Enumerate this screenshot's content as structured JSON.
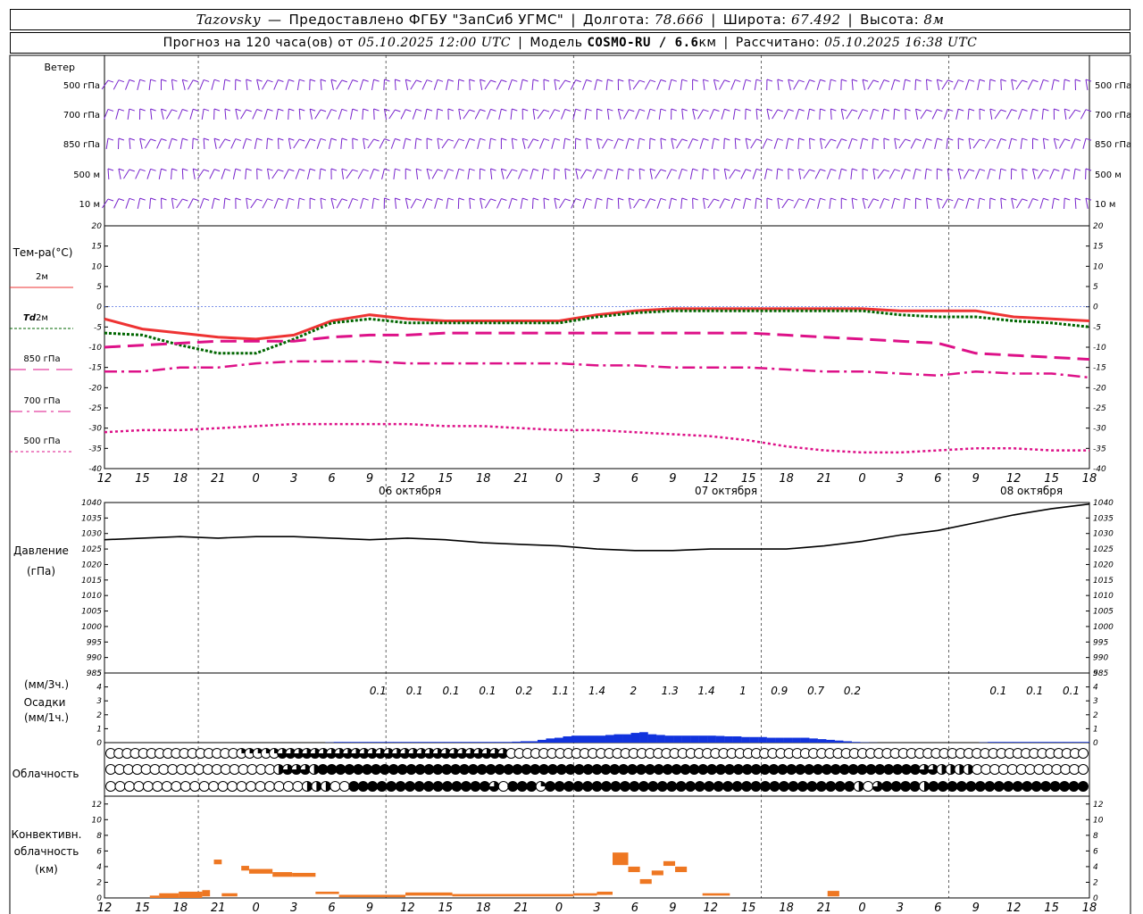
{
  "header": {
    "station": "Tazovsky",
    "dash": "—",
    "provider": "Предоставлено ФГБУ \"ЗапСиб УГМС\"",
    "lon_label": "Долгота:",
    "lon_value": "78.666",
    "lat_label": "Широта:",
    "lat_value": "67.492",
    "alt_label": "Высота:",
    "alt_value": "8м",
    "forecast_label": "Прогноз на 120 часа(ов) от",
    "forecast_time": "05.10.2025 12:00 UTC",
    "model_label": "Модель",
    "model_name": "COSMO-RU / 6.6",
    "model_unit": "км",
    "computed_label": "Рассчитано:",
    "computed_time": "05.10.2025 16:38 UTC"
  },
  "colors": {
    "t2m": "#ee3333",
    "td2m": "#006600",
    "t850": "#dd1188",
    "t700": "#dd1188",
    "t500": "#dd1188",
    "wind": "#7722cc",
    "pressure": "#000000",
    "precip": "#1133dd",
    "convective": "#ee7722",
    "grid": "#000000"
  },
  "chart_data": [
    {
      "id": "wind",
      "type": "table",
      "title": "Ветер",
      "row_labels": [
        "500 гПа",
        "700 гПа",
        "850 гПа",
        "500 м",
        "10 м"
      ],
      "rows": [
        "FFFFFFFFFFFFFFFFFFFFFFFFFFFFFFFFFFFFFFFFFFFFFFFFFFFFFFFFFFFFFFFFFFFFFFFFFFFFFFFFFFFFFFFFFFFFF",
        "FFFFFFFFFFFFFFFFFFFFFFFFFFFFFFFFFFFFFFFFFFFFFFFFFFFFFFFFFFFFFFFFFFFFFFFFFFFFFFFFFFFFFFFFFFFFF",
        "FFFFFFFFFFFFFFFFFFFFFFFFFFFFFFFFFFFFFFFFFFFFFFFFFFFFFFFFFFFFFFFFFFFFFFFFFFFFFFFFFFFFFFFFFFFFF",
        "FFFFFFFFFFFFFFFFFFFFFFFFFFFFFFFFFFFFFFFFFFFFFFFFFFFFFFFFFFFFFFFFFFFFFFFFFFFFFFFFFFFFFFFFFFFFF",
        "FFFFFFFFFFFFFFFFFFFFFFFFFFFFFFFFFFFFFFFFFFFFFFFFFFFFFFFFFFFFFFFFFFFFFFFFFFFFFFFFFFFFFFFFFFFFF"
      ]
    },
    {
      "id": "temperature",
      "type": "line",
      "title": "Тем-ра(°С)",
      "x": [
        12,
        15,
        18,
        21,
        0,
        3,
        6,
        9,
        12,
        15,
        18,
        21,
        0,
        3,
        6,
        9,
        12,
        15,
        18,
        21,
        0,
        3,
        6,
        9,
        12,
        15,
        18
      ],
      "ylim": [
        -40,
        20
      ],
      "yticks": [
        -40,
        -35,
        -30,
        -25,
        -20,
        -15,
        -10,
        -5,
        0,
        5,
        10,
        15,
        20
      ],
      "series": [
        {
          "name": "2м",
          "values": [
            -3,
            -5.5,
            -6.5,
            -7.5,
            -8,
            -7,
            -3.5,
            -2,
            -3,
            -3.5,
            -3.5,
            -3.5,
            -3.5,
            -2,
            -1,
            -0.5,
            -0.5,
            -0.5,
            -0.5,
            -0.5,
            -0.5,
            -1,
            -1,
            -1,
            -2.5,
            -3,
            -3.5
          ]
        },
        {
          "name": "Td 2м",
          "values": [
            -6.5,
            -7,
            -9.5,
            -11.5,
            -11.5,
            -8,
            -4,
            -3,
            -4,
            -4,
            -4,
            -4,
            -4,
            -2.5,
            -1.5,
            -1,
            -1,
            -1,
            -1,
            -1,
            -1,
            -2,
            -2.5,
            -2.5,
            -3.5,
            -4,
            -5
          ]
        },
        {
          "name": "850 гПа",
          "values": [
            -10,
            -9.5,
            -9,
            -8.5,
            -8.5,
            -8.5,
            -7.5,
            -7,
            -7,
            -6.5,
            -6.5,
            -6.5,
            -6.5,
            -6.5,
            -6.5,
            -6.5,
            -6.5,
            -6.5,
            -7,
            -7.5,
            -8,
            -8.5,
            -9,
            -11.5,
            -12,
            -12.5,
            -13
          ]
        },
        {
          "name": "700 гПа",
          "values": [
            -16,
            -16,
            -15,
            -15,
            -14,
            -13.5,
            -13.5,
            -13.5,
            -14,
            -14,
            -14,
            -14,
            -14,
            -14.5,
            -14.5,
            -15,
            -15,
            -15,
            -15.5,
            -16,
            -16,
            -16.5,
            -17,
            -16,
            -16.5,
            -16.5,
            -17.5
          ]
        },
        {
          "name": "500 гПа",
          "values": [
            -31,
            -30.5,
            -30.5,
            -30,
            -29.5,
            -29,
            -29,
            -29,
            -29,
            -29.5,
            -29.5,
            -30,
            -30.5,
            -30.5,
            -31,
            -31.5,
            -32,
            -33,
            -34.5,
            -35.5,
            -36,
            -36,
            -35.5,
            -35,
            -35,
            -35.5,
            -35.5
          ]
        }
      ]
    },
    {
      "id": "pressure",
      "type": "line",
      "title": "Давление",
      "ylabel": "(гПа)",
      "x": [
        12,
        15,
        18,
        21,
        0,
        3,
        6,
        9,
        12,
        15,
        18,
        21,
        0,
        3,
        6,
        9,
        12,
        15,
        18,
        21,
        0,
        3,
        6,
        9,
        12,
        15,
        18
      ],
      "ylim": [
        985,
        1040
      ],
      "yticks": [
        985,
        990,
        995,
        1000,
        1005,
        1010,
        1015,
        1020,
        1025,
        1030,
        1035,
        1040
      ],
      "series": [
        {
          "name": "",
          "values": [
            1028,
            1028.5,
            1029,
            1028.5,
            1029,
            1029,
            1028.5,
            1028,
            1028.5,
            1028,
            1027,
            1026.5,
            1026,
            1025,
            1024.5,
            1024.5,
            1025,
            1025,
            1025,
            1026,
            1027.5,
            1029.5,
            1031,
            1033.5,
            1036,
            1038,
            1039.5
          ]
        }
      ]
    },
    {
      "id": "precipitation",
      "type": "bar",
      "title": "Осадки",
      "ylabel_top": "(мм/3ч.)",
      "ylabel_bottom": "(мм/1ч.)",
      "ylim": [
        0,
        5
      ],
      "yticks": [
        0,
        1,
        2,
        3,
        4,
        5
      ],
      "labels_3h": [
        "",
        "",
        "",
        "",
        "",
        "",
        "",
        "0.1",
        "0.1",
        "0.1",
        "0.1",
        "0.2",
        "1.1",
        "1.4",
        "2",
        "1.3",
        "1.4",
        "1",
        "0.9",
        "0.7",
        "0.2",
        "",
        "",
        "",
        "0.1",
        "0.1",
        "0.1"
      ],
      "hourly": [
        0,
        0,
        0,
        0,
        0,
        0,
        0,
        0,
        0,
        0,
        0,
        0,
        0,
        0,
        0,
        0,
        0,
        0,
        0,
        0,
        0,
        0,
        0,
        0,
        0,
        0,
        0.02,
        0.05,
        0.05,
        0.05,
        0.05,
        0.05,
        0.05,
        0.05,
        0.05,
        0.05,
        0.05,
        0.05,
        0.05,
        0.05,
        0.05,
        0.05,
        0.05,
        0.05,
        0.05,
        0.05,
        0.05,
        0.05,
        0.07,
        0.1,
        0.1,
        0.2,
        0.3,
        0.35,
        0.45,
        0.5,
        0.5,
        0.5,
        0.5,
        0.55,
        0.6,
        0.6,
        0.7,
        0.75,
        0.6,
        0.55,
        0.5,
        0.5,
        0.5,
        0.5,
        0.5,
        0.5,
        0.48,
        0.45,
        0.45,
        0.4,
        0.4,
        0.4,
        0.35,
        0.35,
        0.35,
        0.35,
        0.35,
        0.3,
        0.25,
        0.2,
        0.15,
        0.1,
        0.05,
        0.02,
        0.01,
        0,
        0,
        0,
        0,
        0,
        0,
        0,
        0,
        0,
        0,
        0,
        0,
        0.02,
        0.05,
        0.05,
        0.05,
        0.05,
        0.05,
        0.05,
        0.05,
        0.05,
        0.05,
        0.05,
        0.05,
        0.05
      ]
    },
    {
      "id": "cloudiness",
      "type": "table",
      "title": "Облачность",
      "rows": [
        "○○○○○○○○○○○○○○○○◔◔◔◔◔◕◕◕◕◕◕◕◕◕◕◕◕◕◕◕◕◕◕◕◕◕◕◕◕◕◕◕◕○○○○○○○○○○○○○○○○○○○○○○○○○○○○○○○○○○○○○○○○○○○○○○○○○○○○○○○○○○○○○○○○○○○○○○○",
        "○○○○○○○○○○○○○○○○○○○◐◕◕◕◐●●●●●●●●●●●●●●●●●●●●●●●●●●●●●●●●●●●●●●●●●●●●●●●●●●●●●●●●●●●●●●●●●●●●◕◕◐◐◐◐○○○○○○○○○○○○○",
        "○○○○○○○○○○○○○○○○○○○○○◐◐◐○○●●●●●●●●●●●●●●●◕○●●●◔●●●●●●●●●●●●●●●●●●●●●●●●●●●●●●●●●◐○◕●●●●◑●●●●●●●●●●●●●●●●●"
      ]
    },
    {
      "id": "convective",
      "type": "bar",
      "title": "Конвективн.",
      "title2": "облачность",
      "ylabel": "(км)",
      "ylim": [
        0,
        13
      ],
      "yticks": [
        0,
        2,
        4,
        6,
        8,
        10,
        12
      ],
      "bars": [
        {
          "x0": 5.8,
          "x1": 7.0,
          "base": 0.0,
          "top": 0.3
        },
        {
          "x0": 7.0,
          "x1": 9.5,
          "base": 0.0,
          "top": 0.6
        },
        {
          "x0": 9.5,
          "x1": 12.5,
          "base": 0.0,
          "top": 0.8
        },
        {
          "x0": 12.5,
          "x1": 13.5,
          "base": 0.2,
          "top": 1.0
        },
        {
          "x0": 14.0,
          "x1": 15.0,
          "base": 4.3,
          "top": 4.9
        },
        {
          "x0": 15.0,
          "x1": 17.0,
          "base": 0.2,
          "top": 0.6
        },
        {
          "x0": 17.5,
          "x1": 18.5,
          "base": 3.5,
          "top": 4.1
        },
        {
          "x0": 18.5,
          "x1": 21.5,
          "base": 3.1,
          "top": 3.7
        },
        {
          "x0": 21.5,
          "x1": 24.0,
          "base": 2.7,
          "top": 3.3
        },
        {
          "x0": 24.0,
          "x1": 27.0,
          "base": 2.7,
          "top": 3.2
        },
        {
          "x0": 27.0,
          "x1": 30.0,
          "base": 0.5,
          "top": 0.8
        },
        {
          "x0": 30.0,
          "x1": 38.5,
          "base": 0.1,
          "top": 0.4
        },
        {
          "x0": 38.5,
          "x1": 44.5,
          "base": 0.3,
          "top": 0.7
        },
        {
          "x0": 44.5,
          "x1": 60.0,
          "base": 0.2,
          "top": 0.5
        },
        {
          "x0": 60.0,
          "x1": 63.0,
          "base": 0.3,
          "top": 0.6
        },
        {
          "x0": 63.0,
          "x1": 65.0,
          "base": 0.4,
          "top": 0.8
        },
        {
          "x0": 65.0,
          "x1": 67.0,
          "base": 4.2,
          "top": 5.8
        },
        {
          "x0": 67.0,
          "x1": 68.5,
          "base": 3.3,
          "top": 4.0
        },
        {
          "x0": 68.5,
          "x1": 70.0,
          "base": 1.8,
          "top": 2.4
        },
        {
          "x0": 70.0,
          "x1": 71.5,
          "base": 2.9,
          "top": 3.5
        },
        {
          "x0": 71.5,
          "x1": 73.0,
          "base": 4.1,
          "top": 4.7
        },
        {
          "x0": 73.0,
          "x1": 74.5,
          "base": 3.3,
          "top": 4.0
        },
        {
          "x0": 76.5,
          "x1": 80.0,
          "base": 0.3,
          "top": 0.6
        },
        {
          "x0": 92.5,
          "x1": 94.0,
          "base": 0.2,
          "top": 0.9
        }
      ]
    }
  ],
  "axis": {
    "hour_ticks": [
      "12",
      "15",
      "18",
      "21",
      "0",
      "3",
      "6",
      "9",
      "12",
      "15",
      "18",
      "21",
      "0",
      "3",
      "6",
      "9",
      "12",
      "15",
      "18",
      "21",
      "0",
      "3",
      "6",
      "9",
      "12",
      "15",
      "18"
    ],
    "day_labels": [
      "06 октября",
      "07 октября",
      "08 октября"
    ]
  },
  "legend": {
    "t2m_label": "2м",
    "td_label": "Td",
    "td_suffix": "2м",
    "t850_label": "850 гПа",
    "t700_label": "700 гПа",
    "t500_label": "500 гПа"
  }
}
